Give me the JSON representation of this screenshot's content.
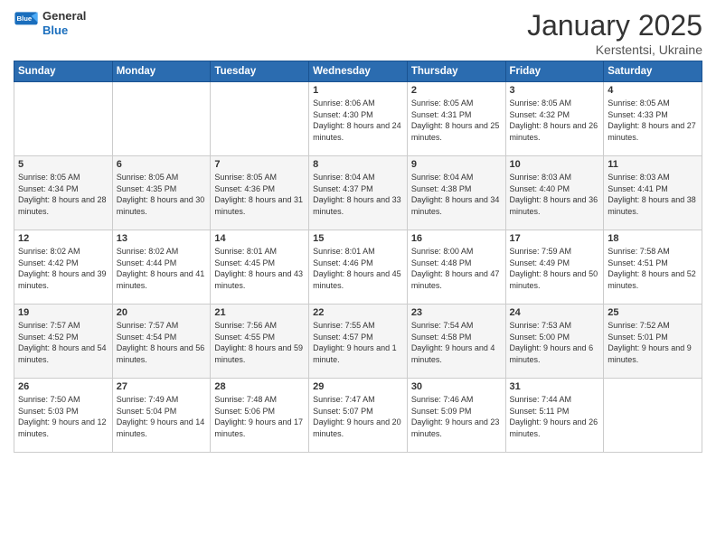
{
  "logo": {
    "general": "General",
    "blue": "Blue"
  },
  "title": "January 2025",
  "subtitle": "Kerstentsi, Ukraine",
  "headers": [
    "Sunday",
    "Monday",
    "Tuesday",
    "Wednesday",
    "Thursday",
    "Friday",
    "Saturday"
  ],
  "weeks": [
    {
      "days": [
        {
          "num": "",
          "detail": ""
        },
        {
          "num": "",
          "detail": ""
        },
        {
          "num": "",
          "detail": ""
        },
        {
          "num": "1",
          "detail": "Sunrise: 8:06 AM\nSunset: 4:30 PM\nDaylight: 8 hours\nand 24 minutes."
        },
        {
          "num": "2",
          "detail": "Sunrise: 8:05 AM\nSunset: 4:31 PM\nDaylight: 8 hours\nand 25 minutes."
        },
        {
          "num": "3",
          "detail": "Sunrise: 8:05 AM\nSunset: 4:32 PM\nDaylight: 8 hours\nand 26 minutes."
        },
        {
          "num": "4",
          "detail": "Sunrise: 8:05 AM\nSunset: 4:33 PM\nDaylight: 8 hours\nand 27 minutes."
        }
      ]
    },
    {
      "days": [
        {
          "num": "5",
          "detail": "Sunrise: 8:05 AM\nSunset: 4:34 PM\nDaylight: 8 hours\nand 28 minutes."
        },
        {
          "num": "6",
          "detail": "Sunrise: 8:05 AM\nSunset: 4:35 PM\nDaylight: 8 hours\nand 30 minutes."
        },
        {
          "num": "7",
          "detail": "Sunrise: 8:05 AM\nSunset: 4:36 PM\nDaylight: 8 hours\nand 31 minutes."
        },
        {
          "num": "8",
          "detail": "Sunrise: 8:04 AM\nSunset: 4:37 PM\nDaylight: 8 hours\nand 33 minutes."
        },
        {
          "num": "9",
          "detail": "Sunrise: 8:04 AM\nSunset: 4:38 PM\nDaylight: 8 hours\nand 34 minutes."
        },
        {
          "num": "10",
          "detail": "Sunrise: 8:03 AM\nSunset: 4:40 PM\nDaylight: 8 hours\nand 36 minutes."
        },
        {
          "num": "11",
          "detail": "Sunrise: 8:03 AM\nSunset: 4:41 PM\nDaylight: 8 hours\nand 38 minutes."
        }
      ]
    },
    {
      "days": [
        {
          "num": "12",
          "detail": "Sunrise: 8:02 AM\nSunset: 4:42 PM\nDaylight: 8 hours\nand 39 minutes."
        },
        {
          "num": "13",
          "detail": "Sunrise: 8:02 AM\nSunset: 4:44 PM\nDaylight: 8 hours\nand 41 minutes."
        },
        {
          "num": "14",
          "detail": "Sunrise: 8:01 AM\nSunset: 4:45 PM\nDaylight: 8 hours\nand 43 minutes."
        },
        {
          "num": "15",
          "detail": "Sunrise: 8:01 AM\nSunset: 4:46 PM\nDaylight: 8 hours\nand 45 minutes."
        },
        {
          "num": "16",
          "detail": "Sunrise: 8:00 AM\nSunset: 4:48 PM\nDaylight: 8 hours\nand 47 minutes."
        },
        {
          "num": "17",
          "detail": "Sunrise: 7:59 AM\nSunset: 4:49 PM\nDaylight: 8 hours\nand 50 minutes."
        },
        {
          "num": "18",
          "detail": "Sunrise: 7:58 AM\nSunset: 4:51 PM\nDaylight: 8 hours\nand 52 minutes."
        }
      ]
    },
    {
      "days": [
        {
          "num": "19",
          "detail": "Sunrise: 7:57 AM\nSunset: 4:52 PM\nDaylight: 8 hours\nand 54 minutes."
        },
        {
          "num": "20",
          "detail": "Sunrise: 7:57 AM\nSunset: 4:54 PM\nDaylight: 8 hours\nand 56 minutes."
        },
        {
          "num": "21",
          "detail": "Sunrise: 7:56 AM\nSunset: 4:55 PM\nDaylight: 8 hours\nand 59 minutes."
        },
        {
          "num": "22",
          "detail": "Sunrise: 7:55 AM\nSunset: 4:57 PM\nDaylight: 9 hours\nand 1 minute."
        },
        {
          "num": "23",
          "detail": "Sunrise: 7:54 AM\nSunset: 4:58 PM\nDaylight: 9 hours\nand 4 minutes."
        },
        {
          "num": "24",
          "detail": "Sunrise: 7:53 AM\nSunset: 5:00 PM\nDaylight: 9 hours\nand 6 minutes."
        },
        {
          "num": "25",
          "detail": "Sunrise: 7:52 AM\nSunset: 5:01 PM\nDaylight: 9 hours\nand 9 minutes."
        }
      ]
    },
    {
      "days": [
        {
          "num": "26",
          "detail": "Sunrise: 7:50 AM\nSunset: 5:03 PM\nDaylight: 9 hours\nand 12 minutes."
        },
        {
          "num": "27",
          "detail": "Sunrise: 7:49 AM\nSunset: 5:04 PM\nDaylight: 9 hours\nand 14 minutes."
        },
        {
          "num": "28",
          "detail": "Sunrise: 7:48 AM\nSunset: 5:06 PM\nDaylight: 9 hours\nand 17 minutes."
        },
        {
          "num": "29",
          "detail": "Sunrise: 7:47 AM\nSunset: 5:07 PM\nDaylight: 9 hours\nand 20 minutes."
        },
        {
          "num": "30",
          "detail": "Sunrise: 7:46 AM\nSunset: 5:09 PM\nDaylight: 9 hours\nand 23 minutes."
        },
        {
          "num": "31",
          "detail": "Sunrise: 7:44 AM\nSunset: 5:11 PM\nDaylight: 9 hours\nand 26 minutes."
        },
        {
          "num": "",
          "detail": ""
        }
      ]
    }
  ]
}
